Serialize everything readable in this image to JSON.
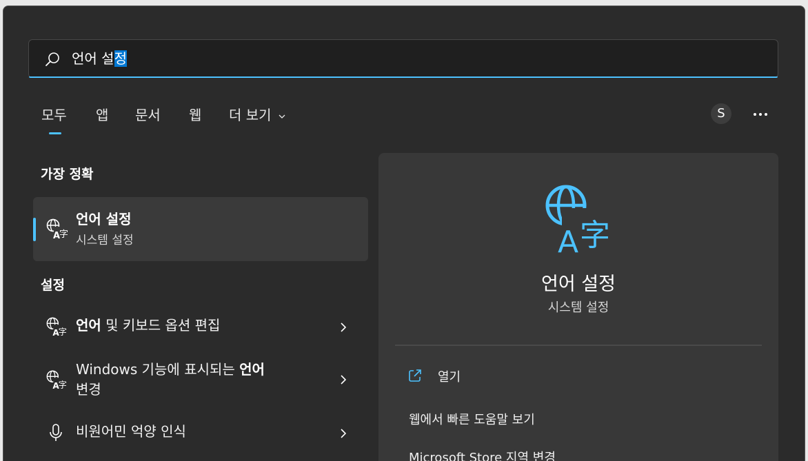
{
  "search": {
    "text_before": "언어 설",
    "text_selected": "정"
  },
  "tabs": [
    {
      "label": "모두"
    },
    {
      "label": "앱"
    },
    {
      "label": "문서"
    },
    {
      "label": "웹"
    },
    {
      "label": "더 보기"
    }
  ],
  "account": {
    "initial": "S"
  },
  "best_match": {
    "heading": "가장 정확",
    "title": "언어 설정",
    "subtitle": "시스템 설정",
    "icon": "language-globe-icon"
  },
  "settings": {
    "heading": "설정",
    "items": [
      {
        "bold": "언어",
        "text": " 및 키보드 옵션 편집",
        "icon": "language-globe-icon"
      },
      {
        "text_before": "Windows 기능에 표시되는 ",
        "bold": "언어",
        "line2": "변경",
        "icon": "language-globe-icon"
      },
      {
        "text": "비원어민 억양 인식",
        "icon": "microphone-icon"
      }
    ]
  },
  "preview": {
    "title": "언어 설정",
    "subtitle": "시스템 설정",
    "actions": [
      {
        "label": "열기",
        "icon": "open-external-icon"
      },
      {
        "label": "웹에서 빠른 도움말 보기"
      },
      {
        "label": "Microsoft Store 지역 변경"
      }
    ]
  },
  "colors": {
    "accent": "#4cc2ff",
    "background": "#2b2b2b",
    "panel": "#383838",
    "selection": "#0078d4"
  }
}
